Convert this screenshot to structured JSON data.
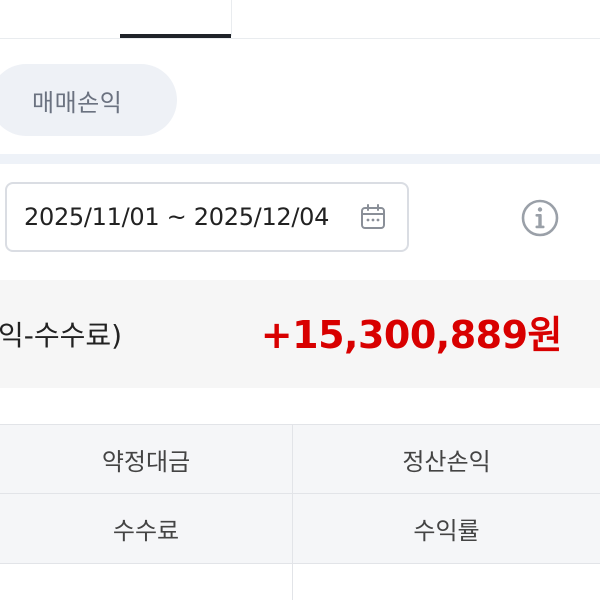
{
  "tabs": {
    "active_index": 1
  },
  "filter_chip": {
    "label": "매매손익"
  },
  "date_range": {
    "text": "2025/11/01 ~ 2025/12/04"
  },
  "summary": {
    "label": "익-수수료)",
    "value": "+15,300,889원",
    "value_color": "#d80000"
  },
  "table": {
    "rows": [
      {
        "left": "약정대금",
        "right": "정산손익"
      },
      {
        "left": "수수료",
        "right": "수익률"
      }
    ]
  },
  "icons": {
    "calendar": "calendar-icon",
    "info": "info-icon"
  }
}
